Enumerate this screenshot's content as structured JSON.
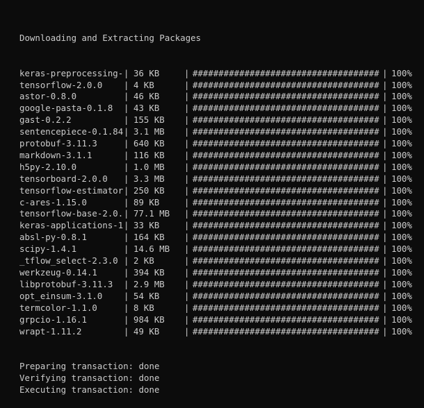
{
  "window": {
    "background": "#0c0c0c",
    "foreground": "#cccccc"
  },
  "header": "Downloading and Extracting Packages",
  "packages": [
    {
      "name": "keras-preprocessing-",
      "size": "36 KB",
      "bar": "####################################",
      "percent": "100%"
    },
    {
      "name": "tensorflow-2.0.0",
      "size": "4 KB",
      "bar": "####################################",
      "percent": "100%"
    },
    {
      "name": "astor-0.8.0",
      "size": "46 KB",
      "bar": "####################################",
      "percent": "100%"
    },
    {
      "name": "google-pasta-0.1.8",
      "size": "43 KB",
      "bar": "####################################",
      "percent": "100%"
    },
    {
      "name": "gast-0.2.2",
      "size": "155 KB",
      "bar": "####################################",
      "percent": "100%"
    },
    {
      "name": "sentencepiece-0.1.84",
      "size": "3.1 MB",
      "bar": "####################################",
      "percent": "100%"
    },
    {
      "name": "protobuf-3.11.3",
      "size": "640 KB",
      "bar": "####################################",
      "percent": "100%"
    },
    {
      "name": "markdown-3.1.1",
      "size": "116 KB",
      "bar": "####################################",
      "percent": "100%"
    },
    {
      "name": "h5py-2.10.0",
      "size": "1.0 MB",
      "bar": "####################################",
      "percent": "100%"
    },
    {
      "name": "tensorboard-2.0.0",
      "size": "3.3 MB",
      "bar": "####################################",
      "percent": "100%"
    },
    {
      "name": "tensorflow-estimator",
      "size": "250 KB",
      "bar": "####################################",
      "percent": "100%"
    },
    {
      "name": "c-ares-1.15.0",
      "size": "89 KB",
      "bar": "####################################",
      "percent": "100%"
    },
    {
      "name": "tensorflow-base-2.0.",
      "size": "77.1 MB",
      "bar": "####################################",
      "percent": "100%"
    },
    {
      "name": "keras-applications-1",
      "size": "33 KB",
      "bar": "####################################",
      "percent": "100%"
    },
    {
      "name": "absl-py-0.8.1",
      "size": "164 KB",
      "bar": "####################################",
      "percent": "100%"
    },
    {
      "name": "scipy-1.4.1",
      "size": "14.6 MB",
      "bar": "####################################",
      "percent": "100%"
    },
    {
      "name": "_tflow_select-2.3.0",
      "size": "2 KB",
      "bar": "####################################",
      "percent": "100%"
    },
    {
      "name": "werkzeug-0.14.1",
      "size": "394 KB",
      "bar": "####################################",
      "percent": "100%"
    },
    {
      "name": "libprotobuf-3.11.3",
      "size": "2.9 MB",
      "bar": "####################################",
      "percent": "100%"
    },
    {
      "name": "opt_einsum-3.1.0",
      "size": "54 KB",
      "bar": "####################################",
      "percent": "100%"
    },
    {
      "name": "termcolor-1.1.0",
      "size": "8 KB",
      "bar": "####################################",
      "percent": "100%"
    },
    {
      "name": "grpcio-1.16.1",
      "size": "984 KB",
      "bar": "####################################",
      "percent": "100%"
    },
    {
      "name": "wrapt-1.11.2",
      "size": "49 KB",
      "bar": "####################################",
      "percent": "100%"
    }
  ],
  "separator": "|",
  "footer": [
    "Preparing transaction: done",
    "Verifying transaction: done",
    "Executing transaction: done"
  ]
}
